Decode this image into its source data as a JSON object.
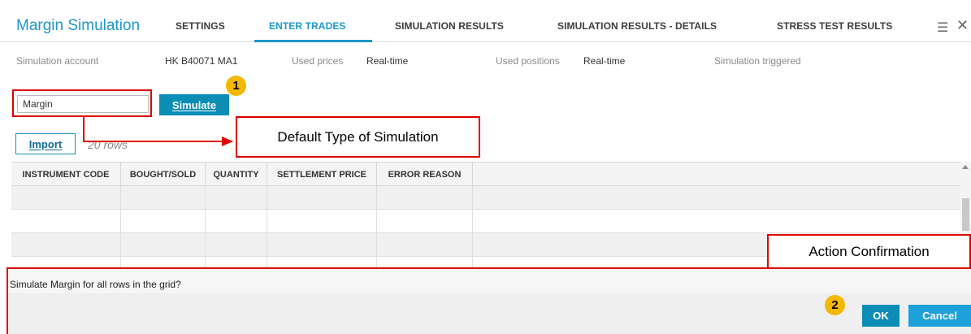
{
  "header": {
    "app_title": "Margin Simulation",
    "tabs": [
      {
        "label": "SETTINGS",
        "active": false
      },
      {
        "label": "ENTER TRADES",
        "active": true
      },
      {
        "label": "SIMULATION RESULTS",
        "active": false
      },
      {
        "label": "SIMULATION RESULTS - DETAILS",
        "active": false
      },
      {
        "label": "STRESS TEST RESULTS",
        "active": false
      }
    ],
    "menu_icon": "hamburger-menu-icon",
    "close_icon": "close-icon"
  },
  "info_bar": {
    "account_label": "Simulation account",
    "account_value": "HK B40071 MA1",
    "prices_label": "Used prices",
    "prices_value": "Real-time",
    "positions_label": "Used positions",
    "positions_value": "Real-time",
    "triggered_label": "Simulation triggered"
  },
  "simulation": {
    "type_value": "Margin",
    "simulate_label": "Simulate"
  },
  "import": {
    "button_label": "Import",
    "rows_text": "20 rows"
  },
  "grid": {
    "columns": [
      "INSTRUMENT CODE",
      "BOUGHT/SOLD",
      "QUANTITY",
      "SETTLEMENT PRICE",
      "ERROR REASON"
    ]
  },
  "annotations": {
    "badge_1": "1",
    "badge_2": "2",
    "default_type_label": "Default Type of Simulation",
    "action_confirmation_label": "Action Confirmation"
  },
  "confirm": {
    "message": "Simulate Margin for all rows in the grid?",
    "ok_label": "OK",
    "cancel_label": "Cancel"
  },
  "colors": {
    "accent": "#1e96c8",
    "primary_button": "#0b8db6",
    "annotation_red": "#e00000",
    "badge_yellow": "#f5b800"
  }
}
